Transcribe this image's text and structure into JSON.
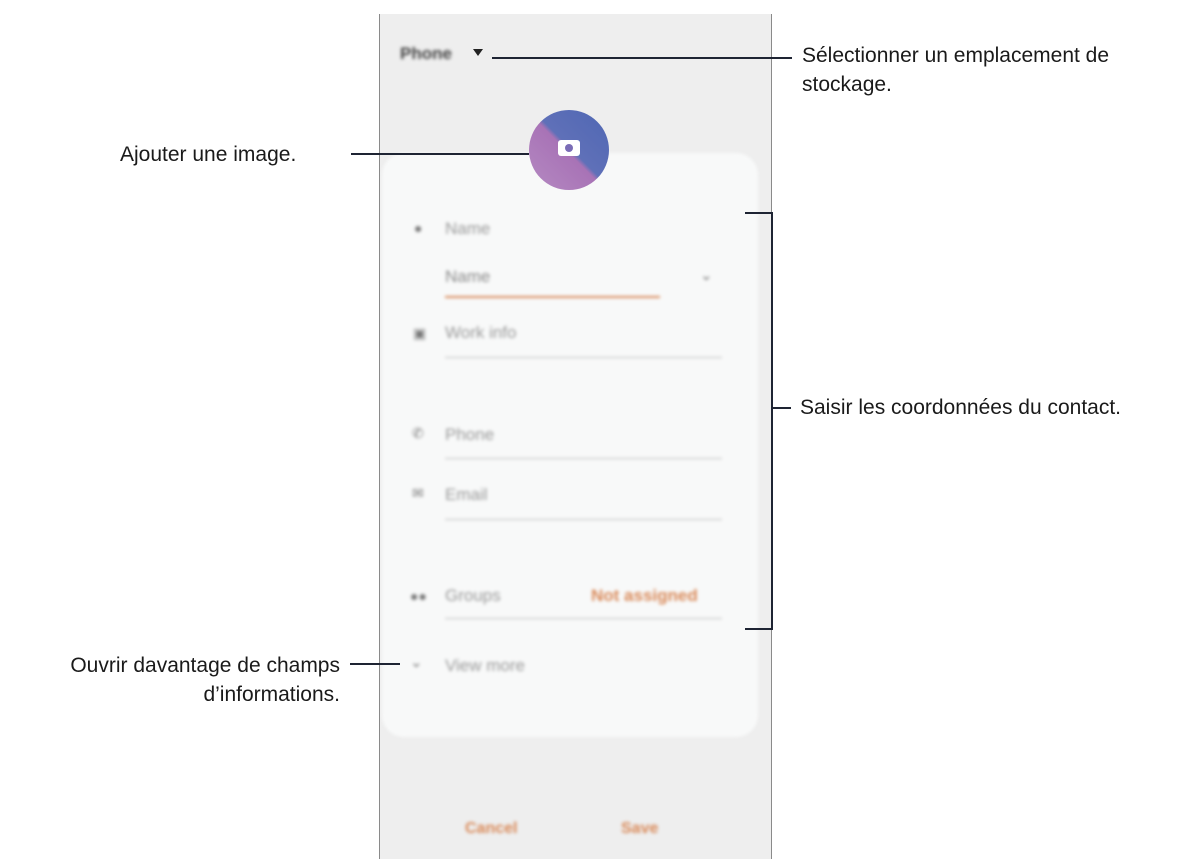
{
  "phone": {
    "storage_label": "Phone",
    "fields": {
      "name_label": "Name",
      "name_input": "Name",
      "work_info": "Work info",
      "phone": "Phone",
      "email": "Email",
      "groups": "Groups",
      "groups_value": "Not assigned",
      "view_more": "View more"
    },
    "buttons": {
      "cancel": "Cancel",
      "save": "Save"
    },
    "colors": {
      "accent": "#d98a5a",
      "underline_active": "#d98a5a"
    }
  },
  "annotations": {
    "storage": "Sélectionner un emplacement de stockage.",
    "add_image": "Ajouter une image.",
    "contact_info": "Saisir les coordonnées du contact.",
    "more_fields": "Ouvrir davantage de champs d’informations."
  }
}
